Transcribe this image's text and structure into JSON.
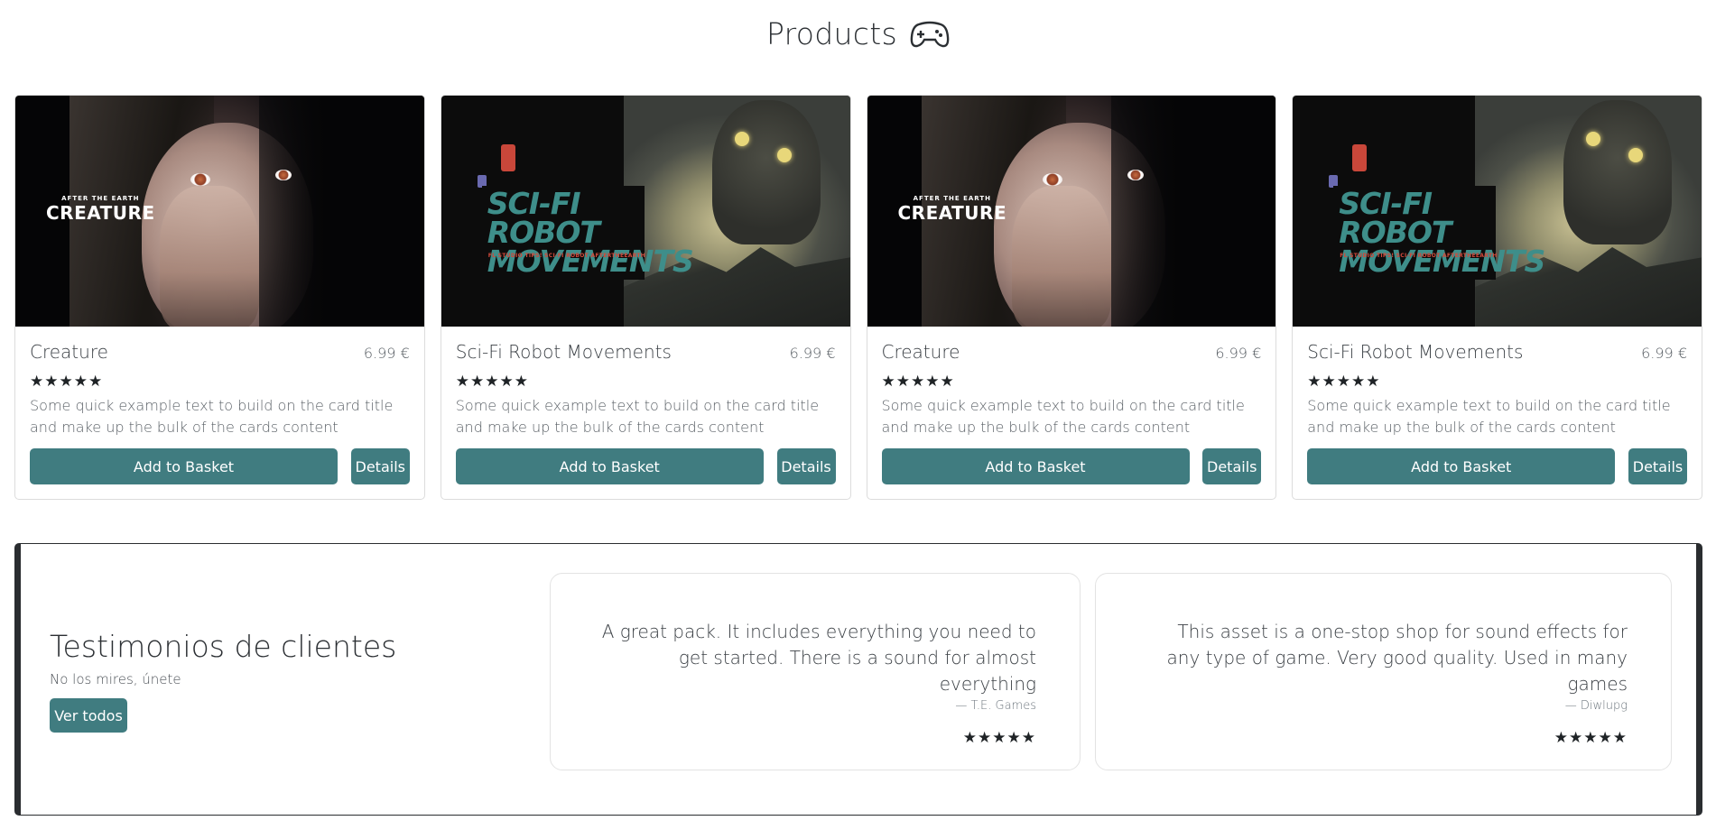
{
  "header": {
    "title": "Products",
    "icon": "gamepad-icon"
  },
  "products": [
    {
      "name": "Creature",
      "price": "6.99 €",
      "rating_stars": "★★★★★",
      "rating": 5,
      "description": "Some quick example text to build on the card title and make up the bulk of the cards content",
      "poster": {
        "top": "AFTER THE EARTH",
        "main": "CREATURE"
      },
      "add_label": "Add to Basket",
      "details_label": "Details"
    },
    {
      "name": "Sci-Fi Robot Movements",
      "price": "6.99 €",
      "rating_stars": "★★★★★",
      "rating": 5,
      "description": "Some quick example text to build on the card title and make up the bulk of the cards content",
      "poster": {
        "main": "SCI-FI ROBOT MOVEMENTS",
        "tagline": "FL STUDIO TIPS! SCI-FI ROBOT AFTERTHEEARTH"
      },
      "add_label": "Add to Basket",
      "details_label": "Details"
    },
    {
      "name": "Creature",
      "price": "6.99 €",
      "rating_stars": "★★★★★",
      "rating": 5,
      "description": "Some quick example text to build on the card title and make up the bulk of the cards content",
      "poster": {
        "top": "AFTER THE EARTH",
        "main": "CREATURE"
      },
      "add_label": "Add to Basket",
      "details_label": "Details"
    },
    {
      "name": "Sci-Fi Robot Movements",
      "price": "6.99 €",
      "rating_stars": "★★★★★",
      "rating": 5,
      "description": "Some quick example text to build on the card title and make up the bulk of the cards content",
      "poster": {
        "main": "SCI-FI ROBOT MOVEMENTS",
        "tagline": "FL STUDIO TIPS! SCI-FI ROBOT AFTERTHEEARTH"
      },
      "add_label": "Add to Basket",
      "details_label": "Details"
    }
  ],
  "testimonials": {
    "heading": "Testimonios de clientes",
    "subheading": "No los mires, únete",
    "view_all_label": "Ver todos",
    "quotes": [
      {
        "text": "A great pack. It includes everything you need to get started. There is a sound for almost everything",
        "author": "— T.E. Games",
        "rating_stars": "★★★★★",
        "rating": 5
      },
      {
        "text": "This asset is a one-stop shop for sound effects for any type of game. Very good quality. Used in many games",
        "author": "— Diwlupg",
        "rating_stars": "★★★★★",
        "rating": 5
      }
    ]
  },
  "colors": {
    "accent": "#407c80",
    "border": "#dcdcdc",
    "section_border": "#2a2d30"
  }
}
